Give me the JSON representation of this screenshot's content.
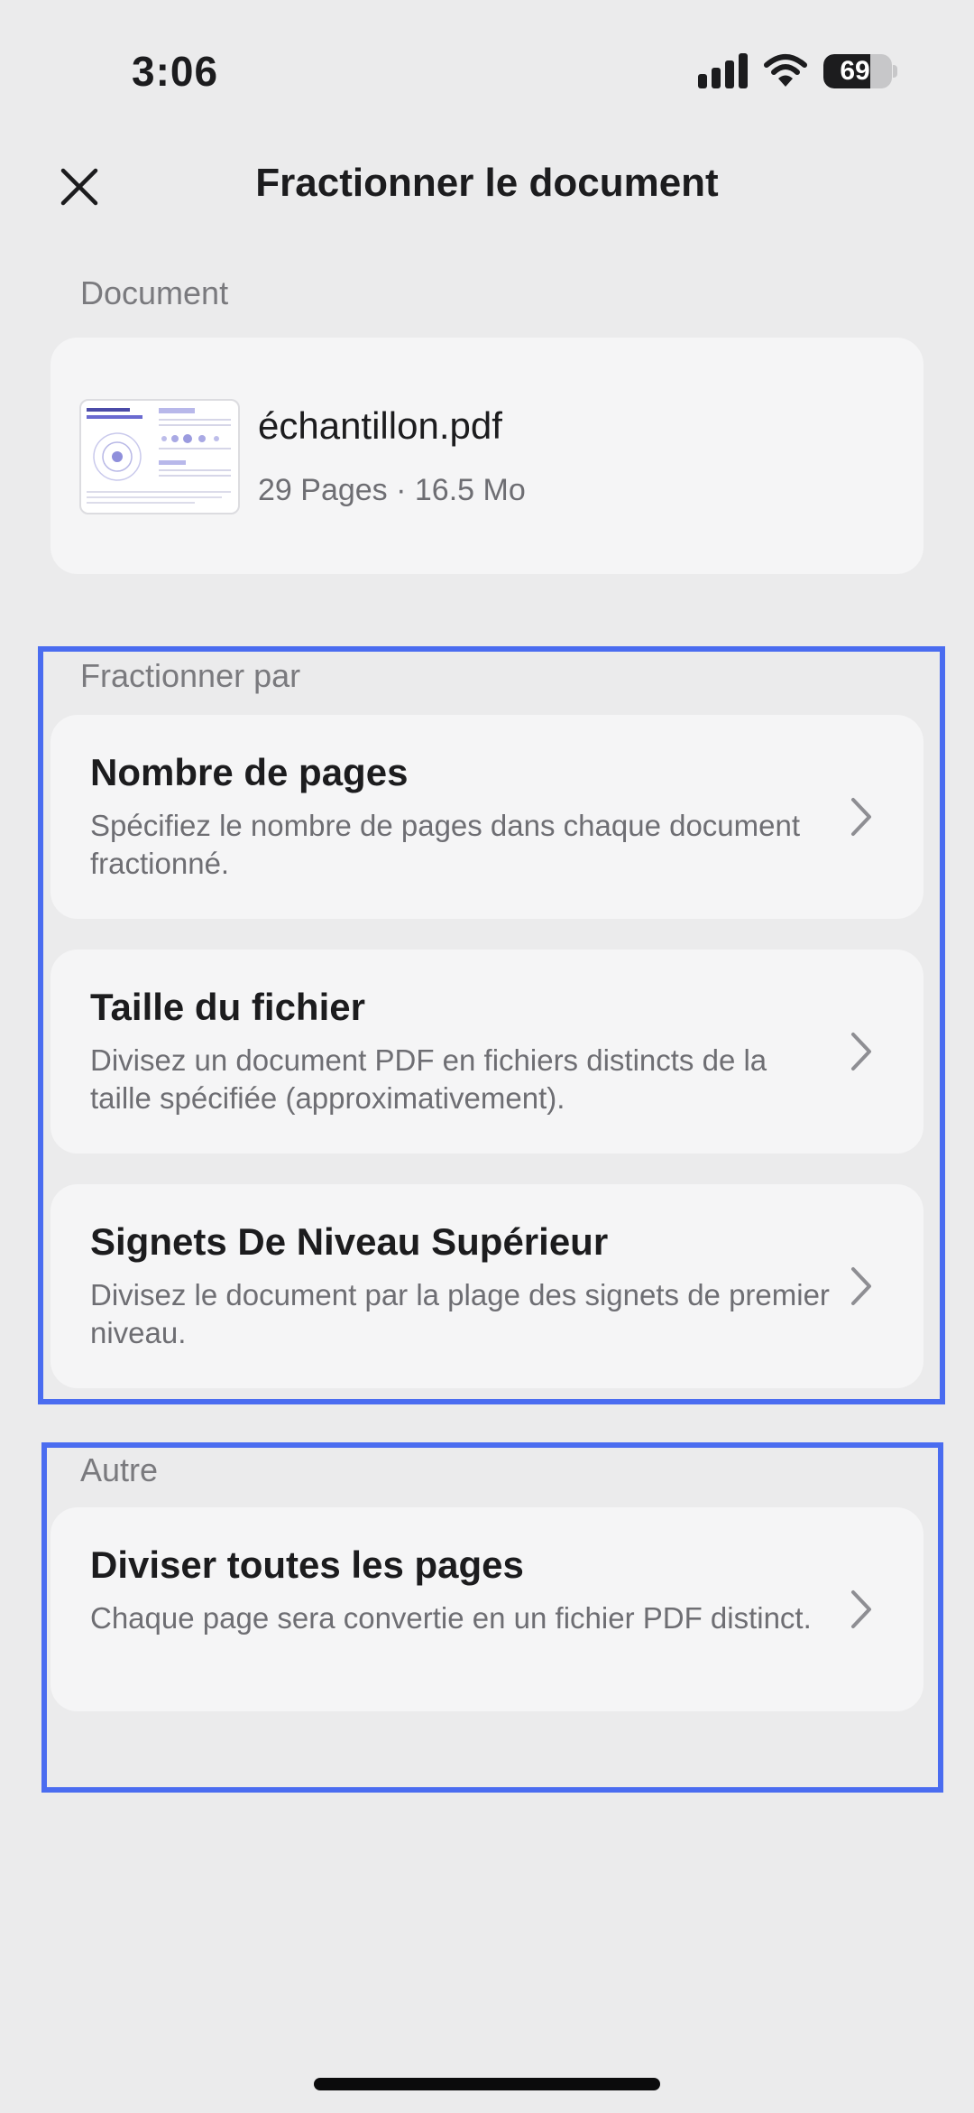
{
  "status_bar": {
    "time": "3:06",
    "battery_level": "69",
    "battery_fraction": 0.69
  },
  "header": {
    "title": "Fractionner le document",
    "close_icon": "close-icon"
  },
  "document_section": {
    "label": "Document",
    "file_name": "échantillon.pdf",
    "file_meta": "29 Pages · 16.5 Mo"
  },
  "split_by_section": {
    "label": "Fractionner par",
    "options": [
      {
        "title": "Nombre de pages",
        "description": "Spécifiez le nombre de pages dans chaque document fractionné."
      },
      {
        "title": "Taille du fichier",
        "description": "Divisez un document PDF en fichiers distincts de la taille spécifiée (approximativement)."
      },
      {
        "title": "Signets De Niveau Supérieur",
        "description": "Divisez le document par la plage des signets de premier niveau."
      }
    ]
  },
  "other_section": {
    "label": "Autre",
    "options": [
      {
        "title": "Diviser toutes les pages",
        "description": "Chaque page sera convertie en un fichier PDF distinct."
      }
    ]
  },
  "colors": {
    "background": "#ebebec",
    "card": "#f5f5f6",
    "highlight": "#4a6cf0",
    "primary_text": "#1c1c1e",
    "secondary_text": "#6e6e73"
  }
}
